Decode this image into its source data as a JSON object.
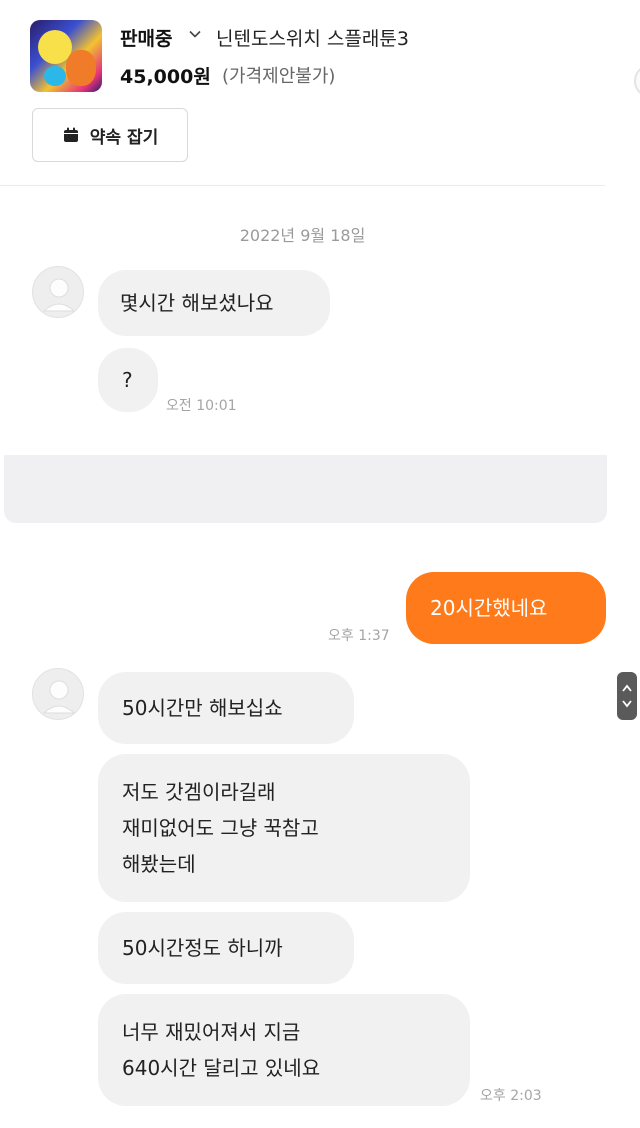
{
  "listing": {
    "status": "판매중",
    "title": "닌텐도스위치 스플래툰3",
    "price": "45,000원",
    "price_note": "(가격제안불가)",
    "appointment_button": "약속 잡기"
  },
  "chat": {
    "date": "2022년 9월 18일",
    "time_1": "오전 10:01",
    "time_2": "오후 1:37",
    "time_3": "오후 2:03",
    "messages": [
      {
        "from": "other",
        "text": "몇시간 해보셨나요"
      },
      {
        "from": "other",
        "text": "?"
      },
      {
        "from": "me",
        "text": "20시간했네요"
      },
      {
        "from": "other",
        "text": "50시간만 해보십쇼"
      },
      {
        "from": "other",
        "lines": [
          "저도 갓겜이라길래",
          "재미없어도 그냥 꾹참고",
          "해봤는데"
        ]
      },
      {
        "from": "other",
        "text": "50시간정도 하니까"
      },
      {
        "from": "other",
        "lines": [
          "너무 재밌어져서 지금",
          "640시간 달리고 있네요"
        ]
      }
    ]
  },
  "colors": {
    "my_bubble": "#ff7a1a",
    "other_bubble": "#f1f1f1"
  },
  "icons": {
    "calendar": "calendar-icon",
    "chevron": "chevron-down-icon",
    "scroll": "scroll-arrows-icon"
  }
}
